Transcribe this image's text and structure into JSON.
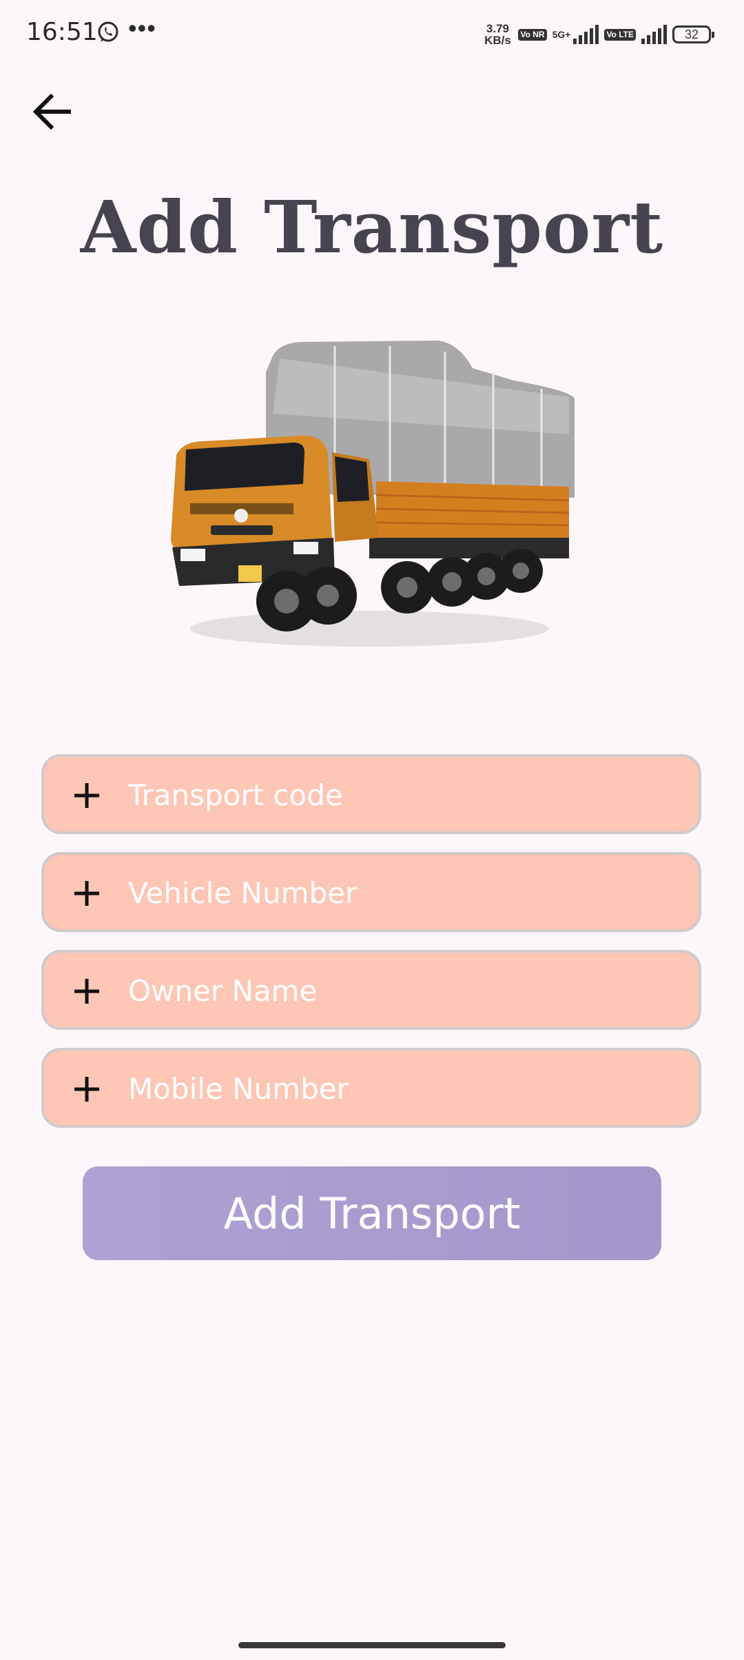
{
  "status_bar": {
    "time": "16:51",
    "speed_value": "3.79",
    "speed_unit": "KB/s",
    "tag_vonr": "Vo NR",
    "network_5g": "5G+",
    "tag_volte": "Vo LTE",
    "battery": "32"
  },
  "header": {
    "back_icon": "arrow-left-icon",
    "title": "Add Transport"
  },
  "form": {
    "fields": [
      {
        "placeholder": "Transport code",
        "value": ""
      },
      {
        "placeholder": "Vehicle Number",
        "value": ""
      },
      {
        "placeholder": "Owner Name",
        "value": ""
      },
      {
        "placeholder": "Mobile Number",
        "value": ""
      }
    ],
    "submit_label": "Add Transport"
  },
  "colors": {
    "background": "#fdf7fc",
    "field_fill": "#fec6b5",
    "button_fill": "#a99ccf",
    "title": "#46444f"
  }
}
